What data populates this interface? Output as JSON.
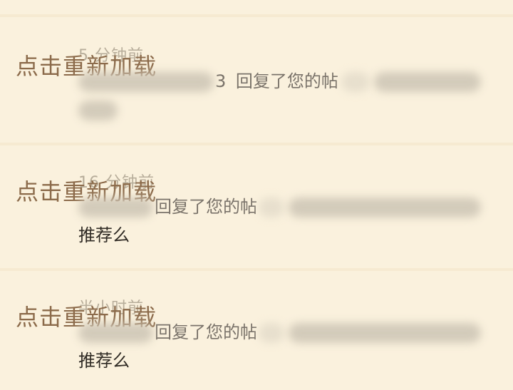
{
  "notifications": [
    {
      "time": "5 分钟前",
      "reload": "点击重新加载",
      "reply_text": "回复了您的帖",
      "prefix_visible": "3"
    },
    {
      "time": "16 分钟前",
      "reload": "点击重新加载",
      "reply_text": "回复了您的帖",
      "second_line": "推荐么"
    },
    {
      "time": "半小时前",
      "reload": "点击重新加载",
      "reply_text": "回复了您的帖",
      "second_line": "推荐么"
    }
  ]
}
